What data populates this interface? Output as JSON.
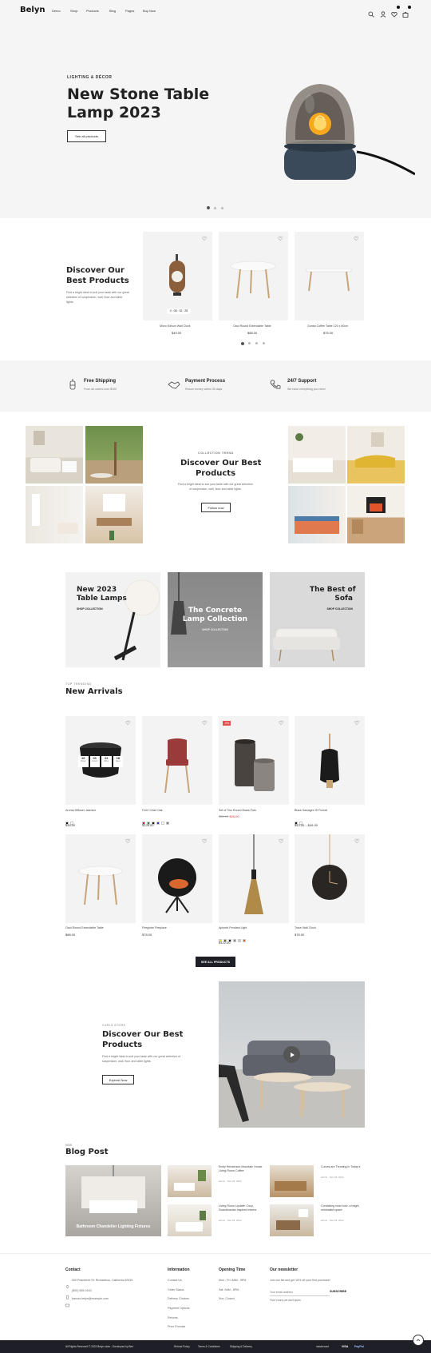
{
  "header": {
    "logo": "Belyn",
    "nav": [
      "Demo",
      "Shop",
      "Products",
      "Blog",
      "Pages",
      "Buy Now"
    ],
    "wishlist_count": "0",
    "cart_count": "0"
  },
  "hero": {
    "eyebrow": "LIGHTING & DÉCOR",
    "title_line1": "New Stone Table",
    "title_line2": "Lamp 2023",
    "button": "See all products"
  },
  "discover": {
    "title_line1": "Discover Our",
    "title_line2": "Best Products",
    "desc": "Find a bright ideal to suit your taste with our great selection of suspension, wall, floor and table lights.",
    "countdown": "0 : 08 : 32 : 28",
    "products": [
      {
        "name": "Micro Edison Wall Clock",
        "price": "$49.00"
      },
      {
        "name": "Oaui Round Extendable Table",
        "price": "$88.00"
      },
      {
        "name": "Gunsa Coffee Table 120 x 60cm",
        "price": "$75.00"
      }
    ]
  },
  "features": [
    {
      "title": "Free Shipping",
      "sub": "From all orders over $100"
    },
    {
      "title": "Payment Process",
      "sub": "Return money within 30 days"
    },
    {
      "title": "24/7 Support",
      "sub": "We have everything you need"
    }
  ],
  "collection": {
    "eyebrow": "COLLECTION TREND",
    "title_line1": "Discover Our Best",
    "title_line2": "Products",
    "desc": "Find a bright ideal to suit your taste with our great selection of suspension, wall, floor and table lights.",
    "button": "Follow now"
  },
  "banners": [
    {
      "title_line1": "New 2023",
      "title_line2": "Table Lamps",
      "link": "SHOP COLLECTION"
    },
    {
      "title_line1": "The Concrete",
      "title_line2": "Lamp Collection",
      "link": "SHOP COLLECTION"
    },
    {
      "title_line1": "The Best of",
      "title_line2": "Sofa",
      "link": "SHOP COLLECTION"
    }
  ],
  "arrivals": {
    "eyebrow": "TOP TRENDING",
    "title": "New Arrivals",
    "countdown": [
      {
        "v": "10",
        "l": "Days"
      },
      {
        "v": "01",
        "l": "Hours"
      },
      {
        "v": "22",
        "l": "Mins"
      },
      {
        "v": "28",
        "l": "Secs"
      }
    ],
    "sale_badge": "-9%",
    "products": [
      {
        "name": "Aroma Diffuser Jasmine",
        "price": "$48.00",
        "old": ""
      },
      {
        "name": "Ferm Chair Oak",
        "price": "$128.00",
        "old": ""
      },
      {
        "name": "Set of Two Round Brass Pots",
        "price": "$26.00",
        "old": "$32.00"
      },
      {
        "name": "Black Sawagen IS Funnel",
        "price": "$43.00 – $49.00",
        "old": ""
      },
      {
        "name": "Oaui Round Extendable Table",
        "price": "$88.00",
        "old": ""
      },
      {
        "name": "Fireglobe Fireplace",
        "price": "$78.00",
        "old": ""
      },
      {
        "name": "Aplomb Pendant Light",
        "price": "$122.00",
        "old": ""
      },
      {
        "name": "Trace Wall Clock",
        "price": "$78.00",
        "old": ""
      }
    ],
    "swatches": {
      "p1": [
        "#111111",
        "#ffffff"
      ],
      "p2": [
        "#b0222e",
        "#3a7d3a",
        "#111111",
        "#1f3fae",
        "#ffffff",
        "#777777"
      ],
      "p4": [
        "#111111",
        "#ffffff"
      ],
      "p7": [
        "#e4e44a",
        "#5a6b2e",
        "#222222",
        "#888888",
        "#cccccc",
        "#c86a2a"
      ]
    },
    "button": "SEE ALL PRODUCTS"
  },
  "video": {
    "eyebrow": "CARLS STORE",
    "title_line1": "Discover Our Best",
    "title_line2": "Products",
    "desc": "Find a bright ideal to suit your taste with our great selection of suspension, wall, floor and table lights.",
    "button": "Explore Now"
  },
  "blog": {
    "eyebrow": "NEW",
    "title": "Blog Post",
    "featured": "Bathroom Chandelier Lighting Fixtures",
    "posts": [
      {
        "title": "Emily Henderson Mountain House Living Room Coffee",
        "meta": "admin · Dec 26, 2022"
      },
      {
        "title": "Curves are Trending in Today's",
        "meta": "admin · Dec 26, 2022"
      },
      {
        "title": "Living Room Update: Cozy, Scandinavian Inspired Interior",
        "meta": "admin · Dec 26, 2022"
      },
      {
        "title": "Combining room tour: a bright, minimalist space",
        "meta": "admin · Dec 26, 2022"
      }
    ]
  },
  "footer": {
    "contact_head": "Contact",
    "address": "500 Peachtree St. Richardson, California 62639",
    "phone": "(800) 555-0163",
    "email": "baroon.belyn@example.com",
    "info_head": "Information",
    "info_links": [
      "Contact Us",
      "Order Status",
      "Delivery Choices",
      "Payment Options",
      "Returns",
      "Price Promise"
    ],
    "hours_head": "Opening Time",
    "hours": [
      "Mon - Fri: 8AM - 9PM",
      "Sat: 9AM - 8PM",
      "Sun: Closed"
    ],
    "news_head": "Our newsletter",
    "news_desc": "Join our list and get 15% off your first purchase!",
    "news_placeholder": "Your email address",
    "news_button": "SUBSCRIBE",
    "news_note": "*Don't worry we don't spam",
    "copyright": "All Rights Reserved © 2023 Belyn-store - Developed by Bee",
    "bottom_links": [
      "Refund Policy",
      "Terms & Conditions",
      "Shipping & Delivery"
    ],
    "payments": [
      "mastercard",
      "VISA",
      "PayPal"
    ]
  }
}
